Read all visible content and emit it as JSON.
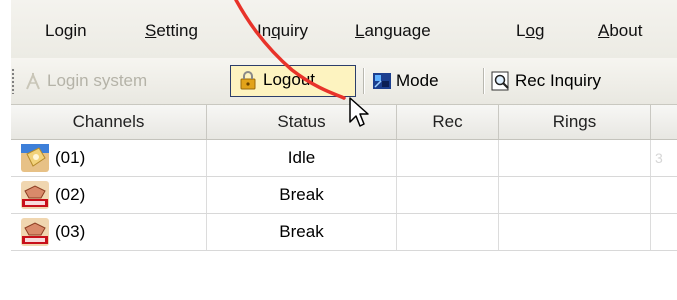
{
  "menu": {
    "items": [
      {
        "pre": "Lo",
        "ul": "g",
        "post": "in"
      },
      {
        "pre": "",
        "ul": "S",
        "post": "etting"
      },
      {
        "pre": "In",
        "ul": "q",
        "post": "uiry"
      },
      {
        "pre": "",
        "ul": "L",
        "post": "anguage"
      },
      {
        "pre": "L",
        "ul": "o",
        "post": "g"
      },
      {
        "pre": "",
        "ul": "A",
        "post": "bout"
      }
    ]
  },
  "toolbar": {
    "login_label": "Login system",
    "logout_label": "Logout",
    "mode_label": "Mode",
    "rec_inquiry_label": "Rec Inquiry"
  },
  "table": {
    "columns": [
      "Channels",
      "Status",
      "Rec",
      "Rings"
    ],
    "rows": [
      {
        "channel": "(01)",
        "status": "Idle",
        "rec": "",
        "rings": "",
        "extra": "3",
        "icon": "phone-idle-icon"
      },
      {
        "channel": "(02)",
        "status": "Break",
        "rec": "",
        "rings": "",
        "extra": "",
        "icon": "no-line-icon"
      },
      {
        "channel": "(03)",
        "status": "Break",
        "rec": "",
        "rings": "",
        "extra": "",
        "icon": "no-line-icon"
      }
    ]
  },
  "icons": {
    "login": "login-icon",
    "logout": "logout-lock-icon",
    "mode": "mode-icon",
    "rec_inquiry": "search-document-icon"
  },
  "colors": {
    "menu_bg": "#ecebe4",
    "hover_bg": "#fdf3c0",
    "hover_border": "#2c3e6b",
    "disabled_text": "#b5b3a8",
    "annotation_red": "#e8332a"
  }
}
